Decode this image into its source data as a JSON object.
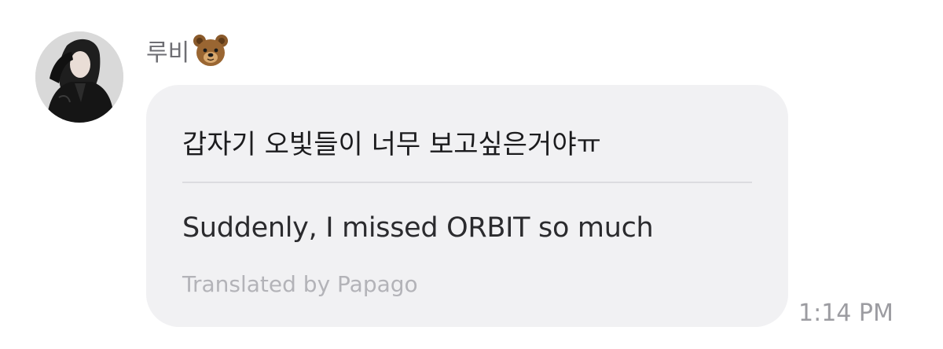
{
  "sender": {
    "name": "루비",
    "emoji_icon": "bear-face-icon"
  },
  "avatar": {
    "icon": "profile-photo-avatar"
  },
  "message": {
    "original_text": "갑자기 오빛들이 너무 보고싶은거야ㅠ",
    "translated_text": "Suddenly, I missed ORBIT so much",
    "translator_note": "Translated by Papago",
    "time": "1:14 PM"
  },
  "colors": {
    "bubble_bg": "#f1f1f3",
    "text_primary": "#1c1c1e",
    "text_secondary": "#6e6e73",
    "text_muted": "#b3b3b8",
    "timestamp": "#9c9ca1"
  }
}
